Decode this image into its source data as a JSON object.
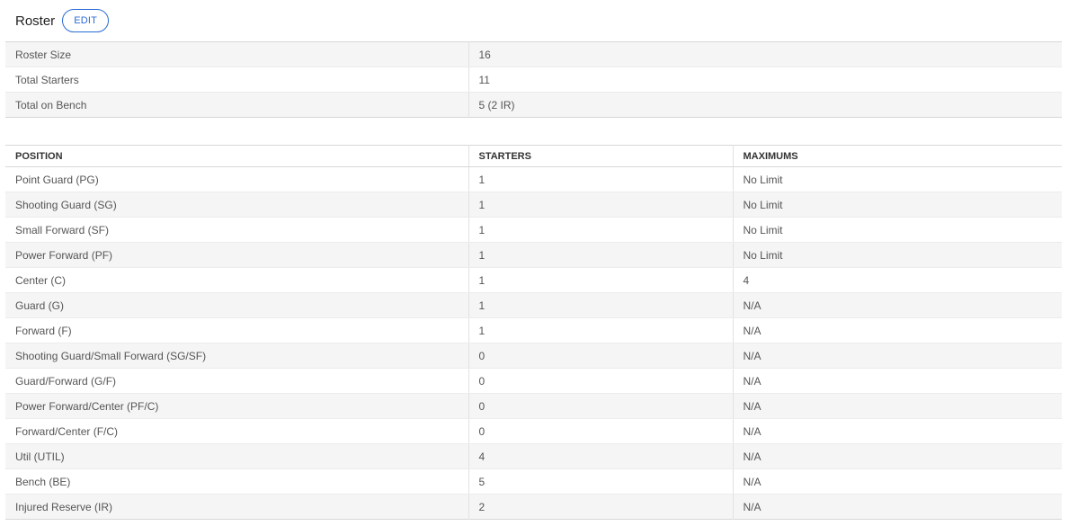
{
  "header": {
    "title": "Roster",
    "edit_label": "EDIT"
  },
  "summary": [
    {
      "label": "Roster Size",
      "value": "16"
    },
    {
      "label": "Total Starters",
      "value": "11"
    },
    {
      "label": "Total on Bench",
      "value": "5 (2 IR)"
    }
  ],
  "positions": {
    "columns": [
      "POSITION",
      "STARTERS",
      "MAXIMUMS"
    ],
    "rows": [
      {
        "position": "Point Guard (PG)",
        "starters": "1",
        "maximums": "No Limit"
      },
      {
        "position": "Shooting Guard (SG)",
        "starters": "1",
        "maximums": "No Limit"
      },
      {
        "position": "Small Forward (SF)",
        "starters": "1",
        "maximums": "No Limit"
      },
      {
        "position": "Power Forward (PF)",
        "starters": "1",
        "maximums": "No Limit"
      },
      {
        "position": "Center (C)",
        "starters": "1",
        "maximums": "4"
      },
      {
        "position": "Guard (G)",
        "starters": "1",
        "maximums": "N/A"
      },
      {
        "position": "Forward (F)",
        "starters": "1",
        "maximums": "N/A"
      },
      {
        "position": "Shooting Guard/Small Forward (SG/SF)",
        "starters": "0",
        "maximums": "N/A"
      },
      {
        "position": "Guard/Forward (G/F)",
        "starters": "0",
        "maximums": "N/A"
      },
      {
        "position": "Power Forward/Center (PF/C)",
        "starters": "0",
        "maximums": "N/A"
      },
      {
        "position": "Forward/Center (F/C)",
        "starters": "0",
        "maximums": "N/A"
      },
      {
        "position": "Util (UTIL)",
        "starters": "4",
        "maximums": "N/A"
      },
      {
        "position": "Bench (BE)",
        "starters": "5",
        "maximums": "N/A"
      },
      {
        "position": "Injured Reserve (IR)",
        "starters": "2",
        "maximums": "N/A"
      }
    ]
  }
}
